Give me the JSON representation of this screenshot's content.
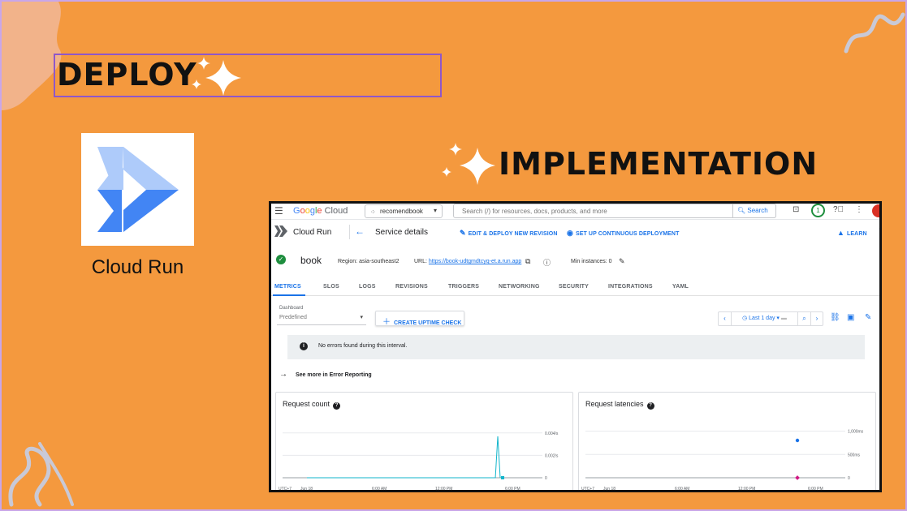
{
  "slide": {
    "deploy_title": "DEPLOY",
    "implementation_title": "IMPLEMENTATION",
    "logo_caption": "Cloud Run",
    "colors": {
      "background": "#f4993e",
      "accent_border": "#8f57c9"
    }
  },
  "console": {
    "topbar": {
      "menu_icon": "hamburger-icon",
      "brand": "Google Cloud",
      "project": "recomendbook",
      "search_placeholder": "Search (/) for resources, docs, products, and more",
      "search_button": "Search",
      "notification_count": "1"
    },
    "service_bar": {
      "product": "Cloud Run",
      "page_title": "Service details",
      "edit_deploy": "EDIT & DEPLOY NEW REVISION",
      "continuous": "SET UP CONTINUOUS DEPLOYMENT",
      "learn": "LEARN"
    },
    "service": {
      "name": "book",
      "region": "Region: asia-southeast2",
      "url_label": "URL:",
      "url": "https://book-udtgmdtcyq-et.a.run.app",
      "min_instances": "Min instances: 0"
    },
    "tabs": [
      "METRICS",
      "SLOS",
      "LOGS",
      "REVISIONS",
      "TRIGGERS",
      "NETWORKING",
      "SECURITY",
      "INTEGRATIONS",
      "YAML"
    ],
    "metrics": {
      "dashboard_label": "Dashboard",
      "dashboard_value": "Predefined",
      "uptime_button": "CREATE UPTIME CHECK",
      "time_range": "Last 1 day",
      "notice": "No errors found during this interval.",
      "see_more": "See more in Error Reporting"
    }
  },
  "chart_data": [
    {
      "type": "line",
      "title": "Request count",
      "x_ticks": [
        "UTC+7",
        "Jun 18",
        "6:00 AM",
        "12:00 PM",
        "6:00 PM"
      ],
      "y_ticks": [
        "0.004/s",
        "0.002/s",
        "0"
      ],
      "ylim": [
        0,
        0.005
      ],
      "series": [
        {
          "values": [
            {
              "x": "Jun 18 00:00",
              "y": 0
            },
            {
              "x": "Jun 18 19:30",
              "y": 0
            },
            {
              "x": "Jun 18 19:45",
              "y": 0.0037
            },
            {
              "x": "Jun 18 20:00",
              "y": 0
            }
          ],
          "color": "#12b5cb"
        }
      ]
    },
    {
      "type": "scatter",
      "title": "Request latencies",
      "x_ticks": [
        "UTC+7",
        "Jun 18",
        "6:00 AM",
        "12:00 PM",
        "6:00 PM"
      ],
      "y_ticks": [
        "1,000ms",
        "500ms",
        "0"
      ],
      "ylim": [
        0,
        1200
      ],
      "series": [
        {
          "values": [
            {
              "x": "Jun 18 19:45",
              "y": 800
            }
          ],
          "color": "#1a73e8"
        },
        {
          "values": [
            {
              "x": "Jun 18 19:45",
              "y": 0
            }
          ],
          "color": "#d01884"
        }
      ]
    }
  ]
}
